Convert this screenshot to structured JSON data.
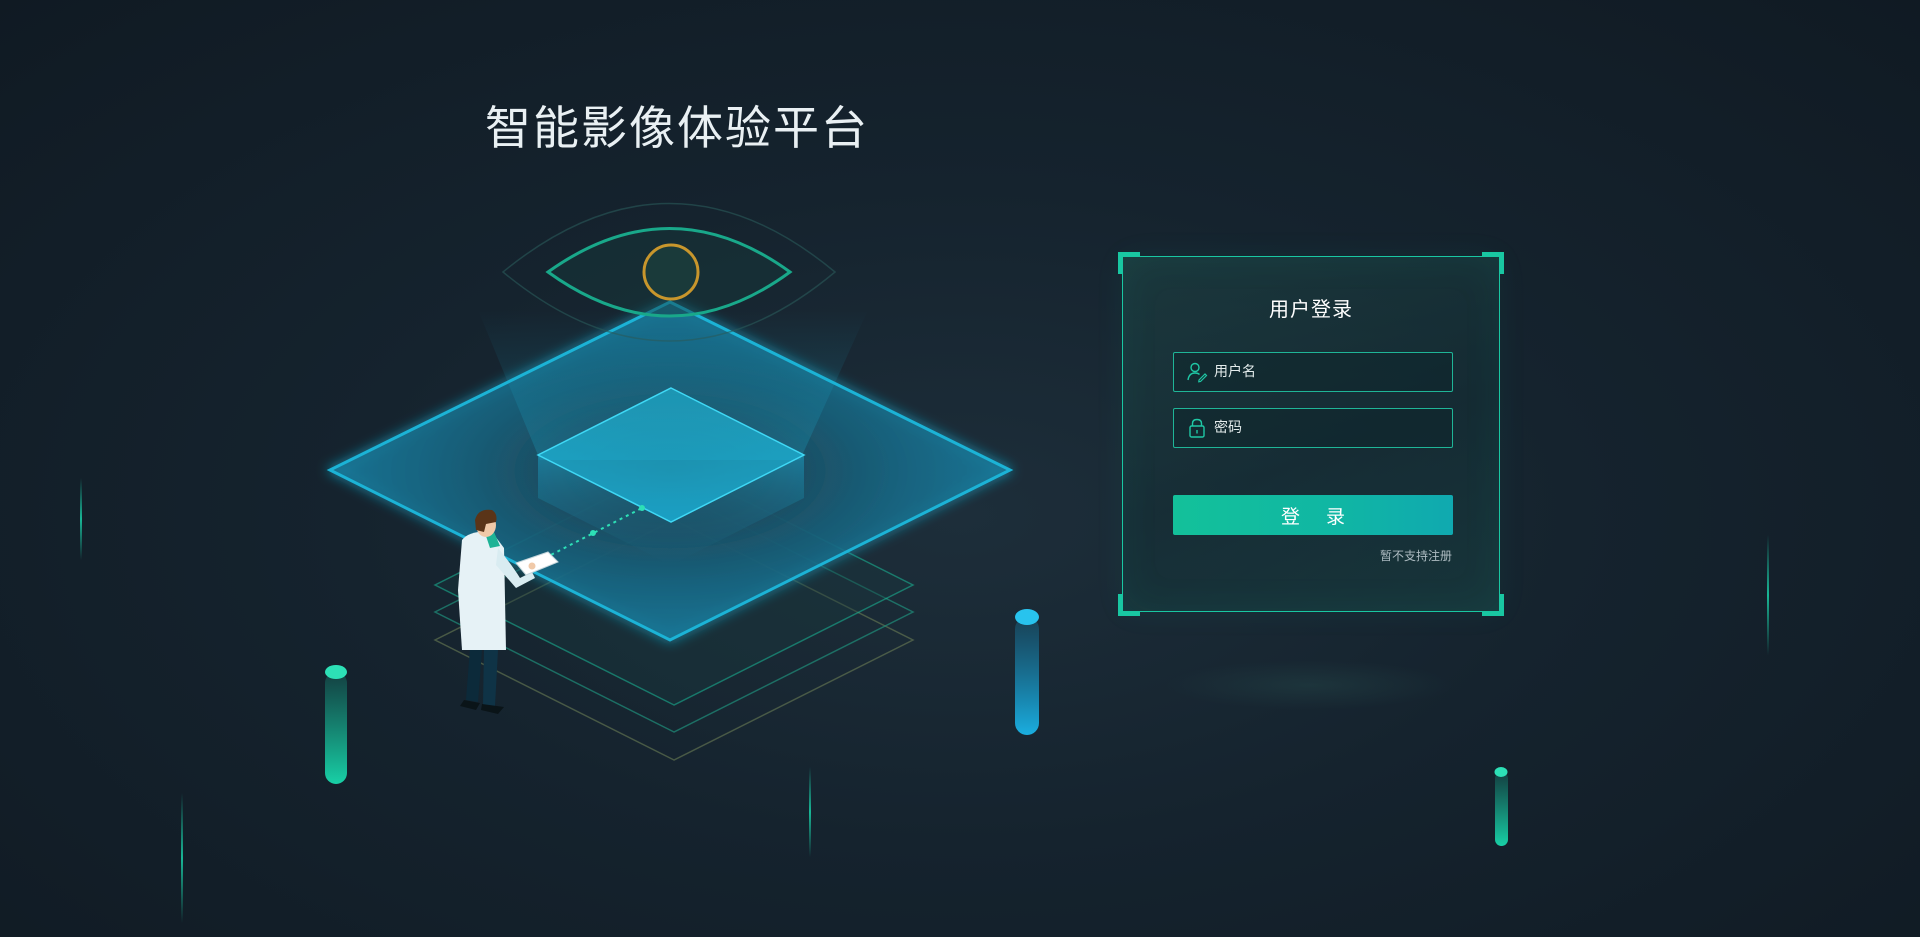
{
  "header": {
    "title": "智能影像体验平台"
  },
  "login": {
    "title": "用户登录",
    "username_placeholder": "用户名",
    "password_placeholder": "密码",
    "submit_label": "登 录",
    "register_note": "暂不支持注册"
  },
  "icons": {
    "username": "user-edit-icon",
    "password": "lock-icon"
  },
  "colors": {
    "accent": "#19c7a2",
    "background": "#15232e",
    "button_start": "#13c19a",
    "button_end": "#10a9b0",
    "cyan_glow": "#1ab3d6"
  }
}
